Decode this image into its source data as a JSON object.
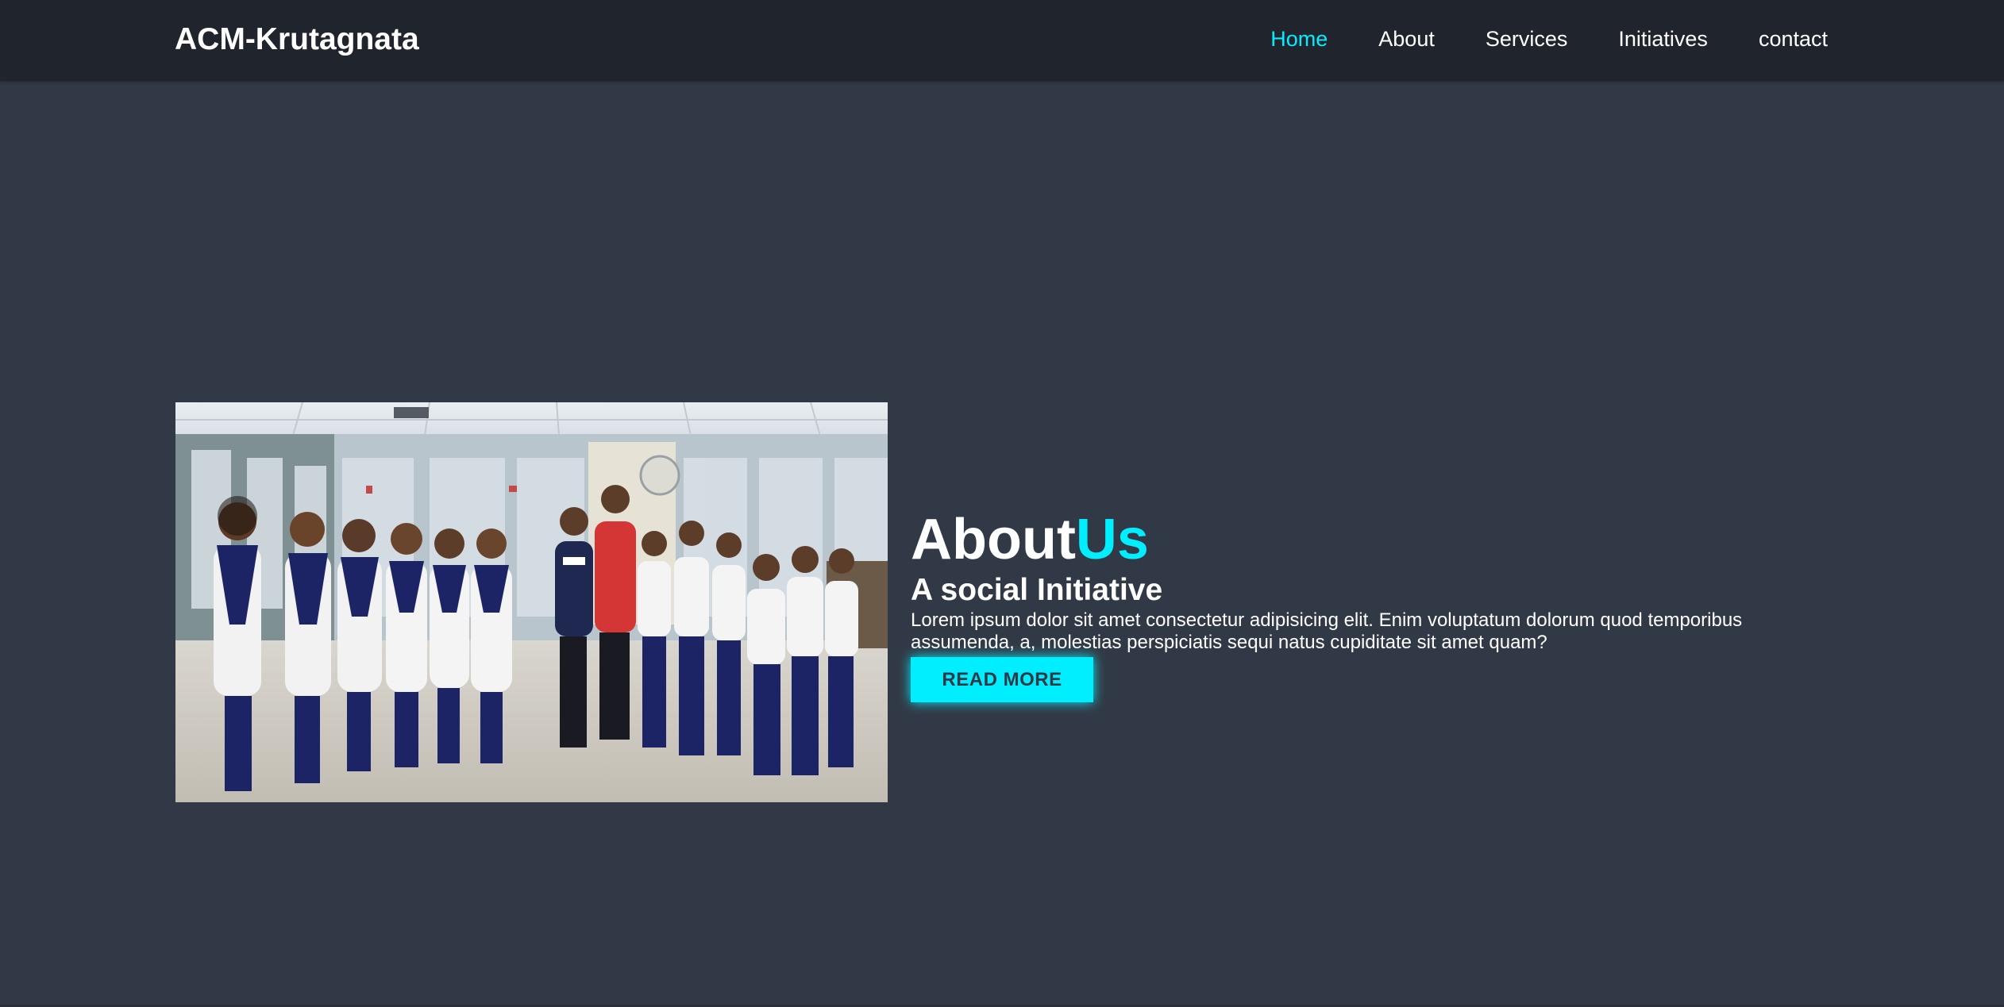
{
  "header": {
    "logo": "ACM-Krutagnata",
    "nav": [
      {
        "label": "Home",
        "active": true
      },
      {
        "label": "About",
        "active": false
      },
      {
        "label": "Services",
        "active": false
      },
      {
        "label": "Initiatives",
        "active": false
      },
      {
        "label": "contact",
        "active": false
      }
    ]
  },
  "about": {
    "heading_main": "About",
    "heading_accent": "Us",
    "subheading": "A social Initiative",
    "description": "Lorem ipsum dolor sit amet consectetur adipisicing elit. Enim voluptatum dolorum quod temporibus assumenda, a, molestias perspiciatis sequi natus cupiditate sit amet quam?",
    "button_label": "READ MORE",
    "image": "group-photo-students"
  },
  "colors": {
    "background": "#323946",
    "header_bg": "#1f242d",
    "accent": "#00eeff",
    "text": "#ffffff"
  }
}
